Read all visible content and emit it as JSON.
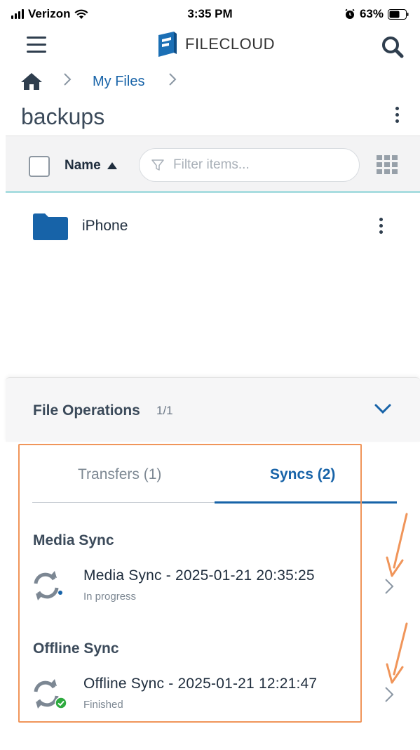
{
  "status_bar": {
    "carrier": "Verizon",
    "time": "3:35 PM",
    "battery": "63%"
  },
  "header": {
    "logo_text_a": "FILE",
    "logo_text_b": "CLOUD"
  },
  "breadcrumb": {
    "item": "My Files"
  },
  "folder": {
    "title": "backups"
  },
  "toolbar": {
    "sort_label": "Name",
    "filter_placeholder": "Filter items..."
  },
  "files": [
    {
      "name": "iPhone"
    }
  ],
  "file_operations": {
    "title": "File Operations",
    "count": "1/1",
    "tabs": [
      {
        "label": "Transfers (1)"
      },
      {
        "label": "Syncs (2)"
      }
    ],
    "sections": [
      {
        "title": "Media Sync",
        "item_name": "Media Sync - 2025-01-21 20:35:25",
        "status": "In progress"
      },
      {
        "title": "Offline Sync",
        "item_name": "Offline Sync - 2025-01-21 12:21:47",
        "status": "Finished"
      }
    ]
  },
  "colors": {
    "accent": "#1763a8",
    "highlight": "#f0955a",
    "success": "#2eaa3f"
  }
}
